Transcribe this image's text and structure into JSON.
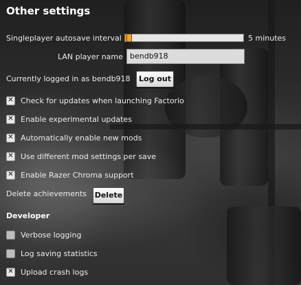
{
  "title": "Other settings",
  "autosave": {
    "label": "Singleplayer autosave interval",
    "value_text": "5 minutes",
    "fill_fraction": 0.06
  },
  "lan_player_name": {
    "label": "LAN player name",
    "value": "bendb918"
  },
  "login": {
    "status_text": "Currently logged in as bendb918",
    "logout_label": "Log out"
  },
  "options": [
    {
      "label": "Check for updates when launching Factorio",
      "checked": true
    },
    {
      "label": "Enable experimental updates",
      "checked": true
    },
    {
      "label": "Automatically enable new mods",
      "checked": true
    },
    {
      "label": "Use different mod settings per save",
      "checked": true
    },
    {
      "label": "Enable Razer Chroma support",
      "checked": true
    }
  ],
  "achievements": {
    "label": "Delete achievements",
    "button_label": "Delete"
  },
  "developer": {
    "heading": "Developer",
    "options": [
      {
        "label": "Verbose logging",
        "checked": false
      },
      {
        "label": "Log saving statistics",
        "checked": false
      },
      {
        "label": "Upload crash logs",
        "checked": true
      }
    ]
  }
}
